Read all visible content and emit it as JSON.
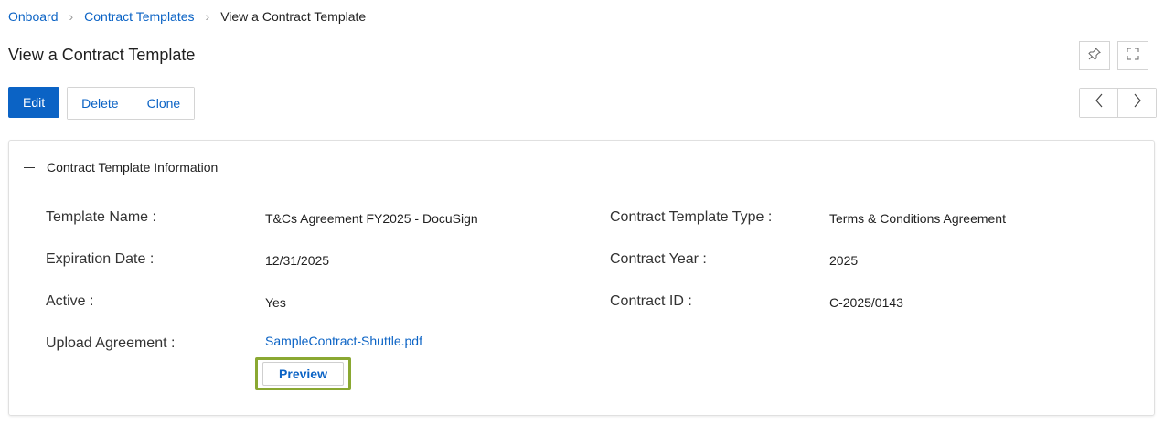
{
  "breadcrumb": {
    "items": [
      "Onboard",
      "Contract Templates"
    ],
    "current": "View a Contract Template",
    "separator": ">"
  },
  "page": {
    "title": "View a Contract Template"
  },
  "toolbar": {
    "edit_label": "Edit",
    "delete_label": "Delete",
    "clone_label": "Clone"
  },
  "panel": {
    "title": "Contract Template Information",
    "fields": {
      "template_name": {
        "label": "Template Name :",
        "value": "T&Cs Agreement FY2025 - DocuSign"
      },
      "contract_template_type": {
        "label": "Contract Template Type :",
        "value": "Terms & Conditions Agreement"
      },
      "expiration_date": {
        "label": "Expiration Date :",
        "value": "12/31/2025"
      },
      "contract_year": {
        "label": "Contract Year :",
        "value": "2025"
      },
      "active": {
        "label": "Active :",
        "value": "Yes"
      },
      "contract_id": {
        "label": "Contract ID :",
        "value": "C-2025/0143"
      },
      "upload_agreement": {
        "label": "Upload Agreement :",
        "file_name": "SampleContract-Shuttle.pdf",
        "preview_label": "Preview"
      }
    }
  },
  "icons": {
    "pin": "pin-icon",
    "fullscreen": "fullscreen-icon",
    "prev": "chevron-left-icon",
    "next": "chevron-right-icon",
    "collapse": "collapse-icon"
  },
  "colors": {
    "accent": "#0b63c5",
    "highlight": "#8aa832",
    "border": "#d4d4d4"
  }
}
